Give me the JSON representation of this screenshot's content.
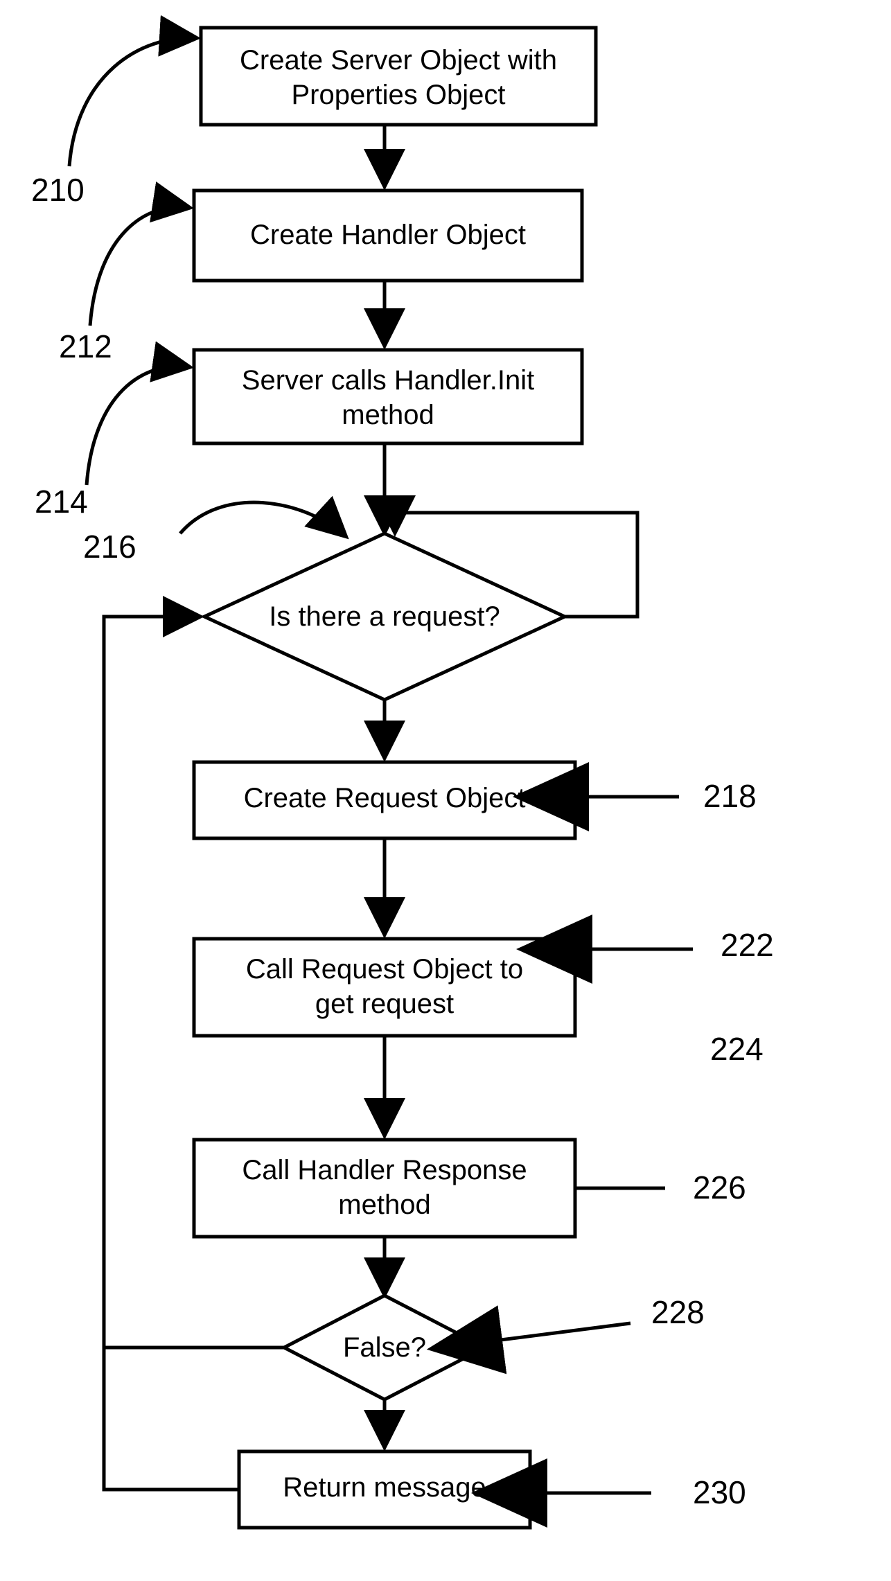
{
  "flowchart": {
    "type": "flowchart",
    "nodes": {
      "n210": {
        "ref": "210",
        "shape": "process",
        "text": [
          "Create Server Object with",
          "Properties Object"
        ]
      },
      "n212": {
        "ref": "212",
        "shape": "process",
        "text": [
          "Create Handler Object"
        ]
      },
      "n214": {
        "ref": "214",
        "shape": "process",
        "text": [
          "Server calls Handler.Init",
          "method"
        ]
      },
      "n216": {
        "ref": "216",
        "shape": "decision",
        "text": [
          "Is there a request?"
        ]
      },
      "n218": {
        "ref": "218",
        "shape": "process",
        "text": [
          "Create Request Object"
        ]
      },
      "n222": {
        "ref": "222",
        "shape": "process",
        "text": [
          "Call Request Object to",
          "get request"
        ]
      },
      "n224": {
        "ref": "224",
        "shape": "none",
        "text": []
      },
      "n226": {
        "ref": "226",
        "shape": "process",
        "text": [
          "Call Handler Response",
          "method"
        ]
      },
      "n228": {
        "ref": "228",
        "shape": "decision",
        "text": [
          "False?"
        ]
      },
      "n230": {
        "ref": "230",
        "shape": "process",
        "text": [
          "Return message"
        ]
      }
    },
    "edges": [
      {
        "from": "n210",
        "to": "n212"
      },
      {
        "from": "n212",
        "to": "n214"
      },
      {
        "from": "n214",
        "to": "n216"
      },
      {
        "from": "n216",
        "to": "n216",
        "note": "self-loop right"
      },
      {
        "from": "n216",
        "to": "n218"
      },
      {
        "from": "n218",
        "to": "n222"
      },
      {
        "from": "n222",
        "to": "n226"
      },
      {
        "from": "n226",
        "to": "n228"
      },
      {
        "from": "n228",
        "to": "n230"
      },
      {
        "from": "n230",
        "to": "n216",
        "note": "loop back left"
      }
    ]
  }
}
